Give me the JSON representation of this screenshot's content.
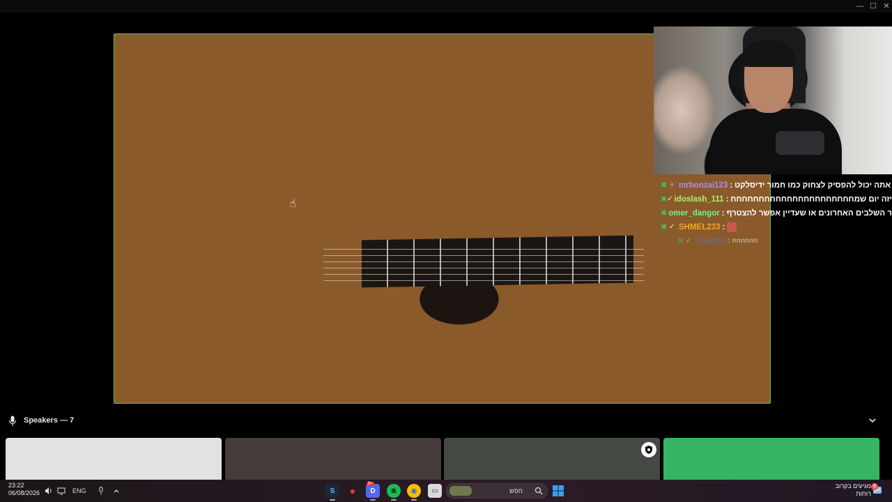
{
  "window": {
    "min": "—",
    "max": "☐",
    "close": "✕"
  },
  "chat": [
    {
      "user": "mrbonzai123",
      "color": "#a58cf5",
      "badge": "✈",
      "sep": ":",
      "msg": "אתה יכול להפסיק לצחוק כמו חמור ידיסלקט"
    },
    {
      "user": "idoslash_111",
      "color": "#a7f56a",
      "badge": "✓",
      "sep": ":",
      "msg": "איזה יום שמחחחחחחחחחחחחחחחחחחחחחח"
    },
    {
      "user": "omer_dangor",
      "color": "#6ef58a",
      "badge": "",
      "sep": ":",
      "msg": "גידו זה כבר השלבים האחרונים או שעדיין אפשר להצטרף"
    },
    {
      "user": "SHMEL233",
      "color": "#f5a623",
      "badge": "✓",
      "sep": ":",
      "msg": ""
    },
    {
      "user": "Chgjjhhh",
      "color": "#3b82f6",
      "badge": "✓",
      "sep": ":",
      "msg": "nnnnnn"
    }
  ],
  "speakers": {
    "label": "Speakers — 7"
  },
  "taskbar": {
    "time": "23:22",
    "date": "06/08/2026",
    "lang": "ENG",
    "search_placeholder": "חפש",
    "weather_line1": "מגיעים בקרוב",
    "weather_line2": "רוחות",
    "notif_count": "8",
    "badge_count": "9+"
  },
  "colors": {
    "tile_border": "#5dbf6b",
    "badge_green": "#3ec95a",
    "speaker_green": "#35b463"
  }
}
